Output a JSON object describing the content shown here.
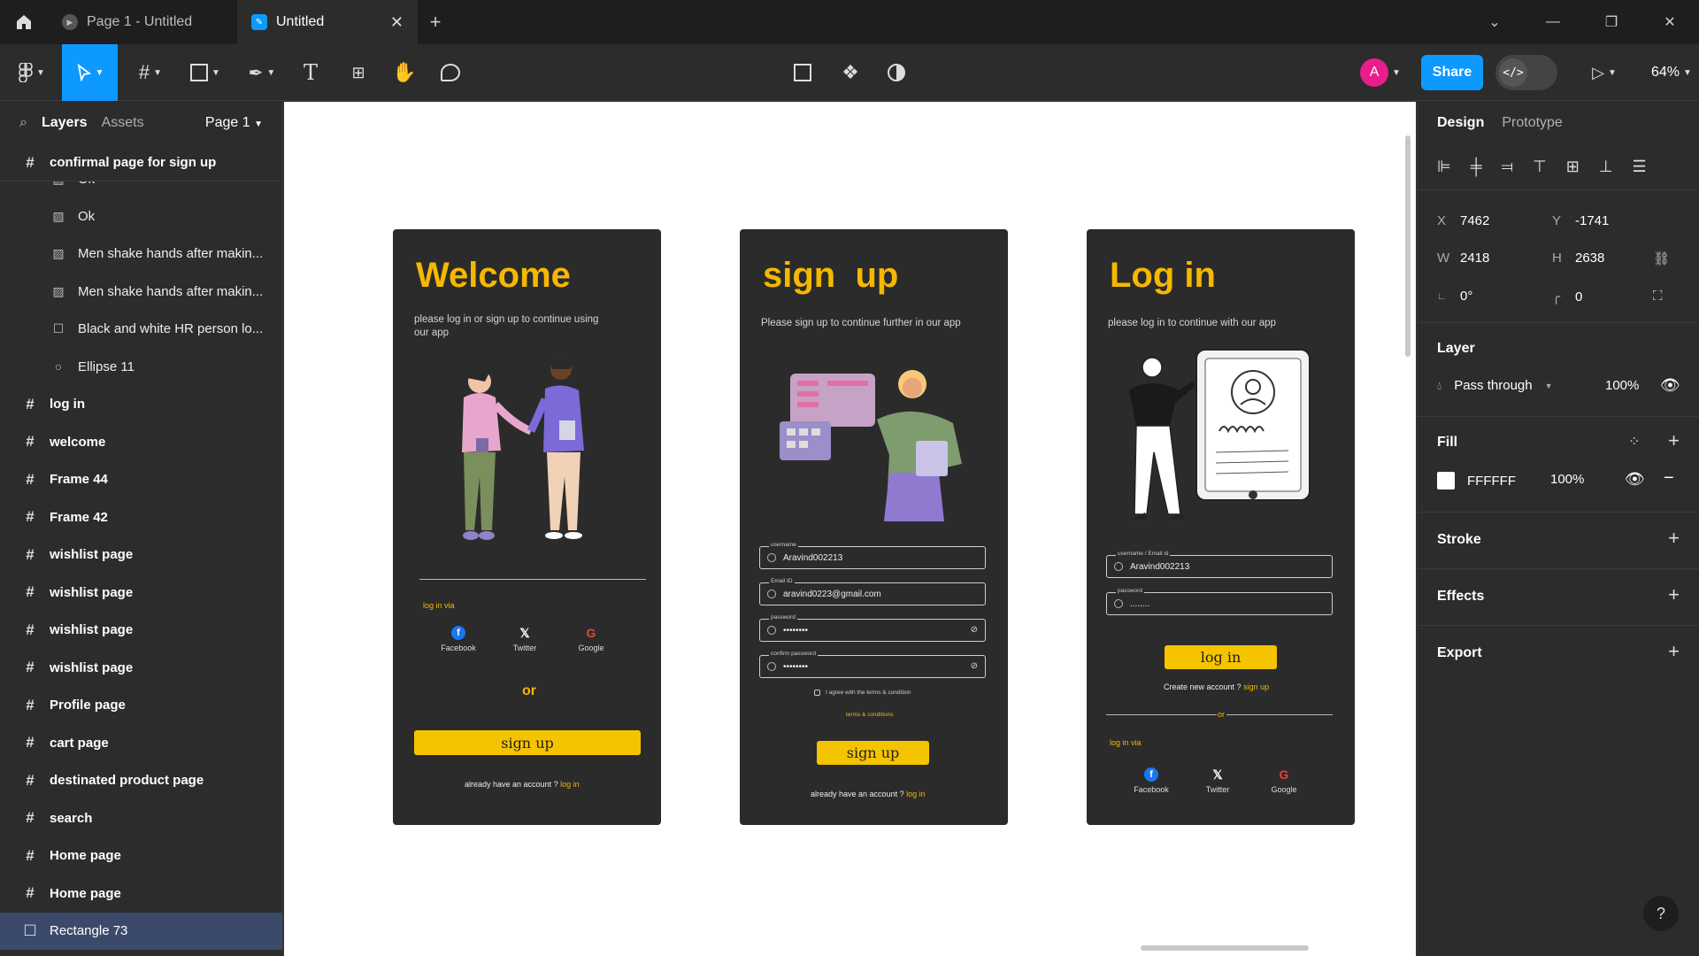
{
  "tabs": [
    {
      "label": "Page 1 - Untitled"
    },
    {
      "label": "Untitled"
    }
  ],
  "toolbar": {
    "share_label": "Share",
    "zoom": "64%",
    "avatar_initial": "A"
  },
  "left_panel": {
    "tab_layers": "Layers",
    "tab_assets": "Assets",
    "page_selector": "Page 1",
    "frame_title": "confirmal page for sign up",
    "children": [
      "Ok",
      "Ok",
      "Men shake hands after makin...",
      "Men shake hands after makin...",
      "Black and white HR person lo...",
      "Ellipse 11"
    ],
    "frames": [
      "log in",
      "welcome",
      "Frame 44",
      "Frame 42",
      "wishlist page",
      "wishlist page",
      "wishlist page",
      "wishlist page",
      "Profile page",
      "cart page",
      "destinated product page",
      "search",
      "Home page",
      "Home page"
    ],
    "selected_layer": "Rectangle 73"
  },
  "screens": {
    "welcome": {
      "title": "Welcome",
      "subtitle": "please log in or sign up to continue using our app",
      "login_via": "log in via",
      "socials": [
        "Facebook",
        "Twitter",
        "Google"
      ],
      "or": "or",
      "button": "sign  up",
      "footer_text": "already have an account ?",
      "footer_link": "log in"
    },
    "signup": {
      "title": "sign  up",
      "subtitle": "Please sign up to continue further in our app",
      "fields": [
        {
          "label": "username",
          "value": "Aravind002213"
        },
        {
          "label": "Email ID",
          "value": "aravind0223@gmail.com"
        },
        {
          "label": "password",
          "value": "••••••••"
        },
        {
          "label": "confirm password",
          "value": "••••••••"
        }
      ],
      "agree": "I agree with the terms & condition",
      "terms": "terms & conditions",
      "button": "sign  up",
      "footer_text": "already have an account ?",
      "footer_link": "log in"
    },
    "login": {
      "title": "Log in",
      "subtitle": "please log in to continue with our app",
      "fields": [
        {
          "label": "username / Email id",
          "value": "Aravind002213"
        },
        {
          "label": "password",
          "value": "........"
        }
      ],
      "button": "log in",
      "create_text": "Create new account ?",
      "create_link": "sign  up",
      "or": "or",
      "login_via": "log in via",
      "socials": [
        "Facebook",
        "Twitter",
        "Google"
      ]
    }
  },
  "right_panel": {
    "tab_design": "Design",
    "tab_prototype": "Prototype",
    "x": "7462",
    "y": "-1741",
    "w": "2418",
    "h": "2638",
    "rotation": "0°",
    "radius": "0",
    "layer_title": "Layer",
    "blend": "Pass through",
    "opacity": "100%",
    "fill_title": "Fill",
    "fill_hex": "FFFFFF",
    "fill_opacity": "100%",
    "stroke_title": "Stroke",
    "effects_title": "Effects",
    "export_title": "Export"
  },
  "colors": {
    "accent": "#0d99ff",
    "brand_yellow": "#f5b800",
    "screen_bg": "#2b2b2b"
  }
}
